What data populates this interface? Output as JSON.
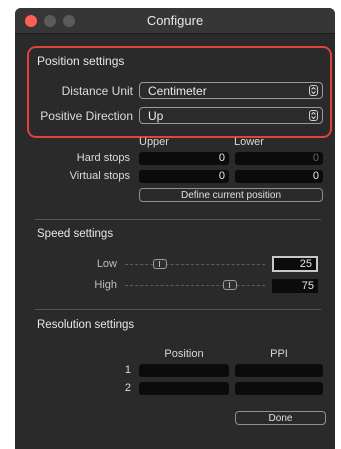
{
  "window": {
    "title": "Configure"
  },
  "position_settings": {
    "title": "Position settings",
    "distance_unit_label": "Distance Unit",
    "distance_unit_value": "Centimeter",
    "positive_direction_label": "Positive Direction",
    "positive_direction_value": "Up",
    "upper_header": "Upper",
    "lower_header": "Lower",
    "hard_stops_label": "Hard stops",
    "hard_stops_upper": "0",
    "hard_stops_lower": "0",
    "virtual_stops_label": "Virtual stops",
    "virtual_stops_upper": "0",
    "virtual_stops_lower": "0",
    "define_button": "Define current position"
  },
  "speed_settings": {
    "title": "Speed settings",
    "low_label": "Low",
    "low_value": "25",
    "low_level": 0.25,
    "high_label": "High",
    "high_value": "75",
    "high_level": 0.75
  },
  "resolution_settings": {
    "title": "Resolution settings",
    "position_header": "Position",
    "ppi_header": "PPI",
    "rows": [
      {
        "label": "1",
        "position": "",
        "ppi": ""
      },
      {
        "label": "2",
        "position": "",
        "ppi": ""
      }
    ]
  },
  "done_button": "Done",
  "colors": {
    "window_bg": "#2a2a2a",
    "highlight": "#e0433a",
    "close": "#fe5f57"
  }
}
